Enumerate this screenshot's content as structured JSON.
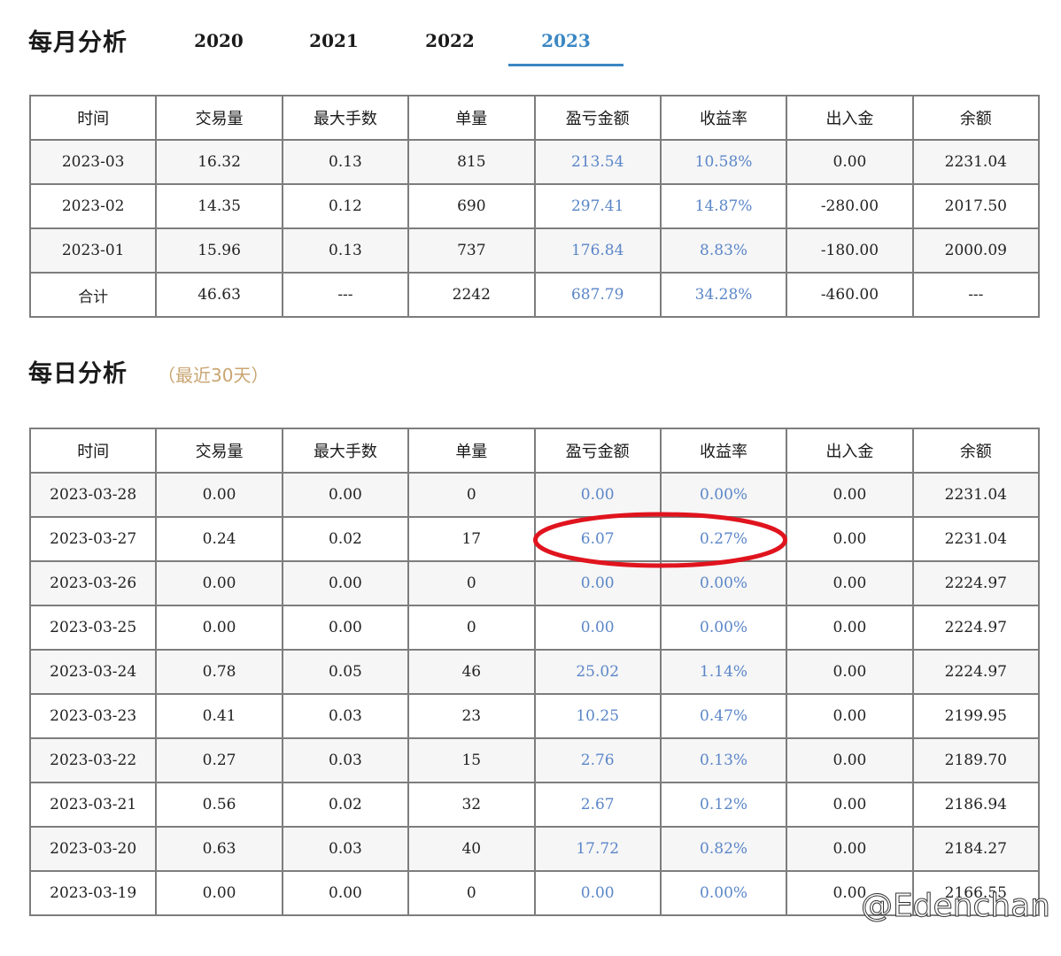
{
  "monthly": {
    "title": "每月分析",
    "tabs": [
      {
        "label": "2020",
        "active": false
      },
      {
        "label": "2021",
        "active": false
      },
      {
        "label": "2022",
        "active": false
      },
      {
        "label": "2023",
        "active": true
      }
    ],
    "headers": [
      "时间",
      "交易量",
      "最大手数",
      "单量",
      "盈亏金额",
      "收益率",
      "出入金",
      "余额"
    ],
    "rows": [
      [
        "2023-03",
        "16.32",
        "0.13",
        "815",
        "213.54",
        "10.58%",
        "0.00",
        "2231.04"
      ],
      [
        "2023-02",
        "14.35",
        "0.12",
        "690",
        "297.41",
        "14.87%",
        "-280.00",
        "2017.50"
      ],
      [
        "2023-01",
        "15.96",
        "0.13",
        "737",
        "176.84",
        "8.83%",
        "-180.00",
        "2000.09"
      ],
      [
        "合计",
        "46.63",
        "---",
        "2242",
        "687.79",
        "34.28%",
        "-460.00",
        "---"
      ]
    ]
  },
  "daily": {
    "title": "每日分析",
    "subtitle": "（最近30天）",
    "headers": [
      "时间",
      "交易量",
      "最大手数",
      "单量",
      "盈亏金额",
      "收益率",
      "出入金",
      "余额"
    ],
    "rows": [
      [
        "2023-03-28",
        "0.00",
        "0.00",
        "0",
        "0.00",
        "0.00%",
        "0.00",
        "2231.04"
      ],
      [
        "2023-03-27",
        "0.24",
        "0.02",
        "17",
        "6.07",
        "0.27%",
        "0.00",
        "2231.04"
      ],
      [
        "2023-03-26",
        "0.00",
        "0.00",
        "0",
        "0.00",
        "0.00%",
        "0.00",
        "2224.97"
      ],
      [
        "2023-03-25",
        "0.00",
        "0.00",
        "0",
        "0.00",
        "0.00%",
        "0.00",
        "2224.97"
      ],
      [
        "2023-03-24",
        "0.78",
        "0.05",
        "46",
        "25.02",
        "1.14%",
        "0.00",
        "2224.97"
      ],
      [
        "2023-03-23",
        "0.41",
        "0.03",
        "23",
        "10.25",
        "0.47%",
        "0.00",
        "2199.95"
      ],
      [
        "2023-03-22",
        "0.27",
        "0.03",
        "15",
        "2.76",
        "0.13%",
        "0.00",
        "2189.70"
      ],
      [
        "2023-03-21",
        "0.56",
        "0.02",
        "32",
        "2.67",
        "0.12%",
        "0.00",
        "2186.94"
      ],
      [
        "2023-03-20",
        "0.63",
        "0.03",
        "40",
        "17.72",
        "0.82%",
        "0.00",
        "2184.27"
      ],
      [
        "2023-03-19",
        "0.00",
        "0.00",
        "0",
        "0.00",
        "0.00%",
        "0.00",
        "2166.55"
      ]
    ]
  },
  "watermark": "@Edenchan",
  "colors": {
    "accent": "#3b87c4",
    "value_blue": "#5b86c8",
    "subtitle": "#c9a571",
    "annotation": "#e0141e"
  }
}
